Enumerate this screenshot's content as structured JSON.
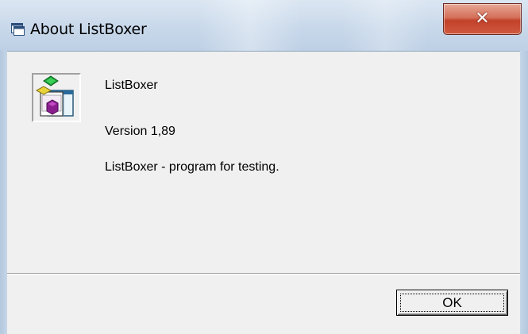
{
  "window": {
    "title": "About ListBoxer",
    "close_glyph": "✕",
    "title_icon": "app-window-icon"
  },
  "about": {
    "app_name": "ListBoxer",
    "version": "Version 1,89",
    "description": "ListBoxer - program for testing.",
    "app_icon": "listboxer-app-icon"
  },
  "buttons": {
    "ok_label": "OK"
  },
  "colors": {
    "close_button": "#c2412a",
    "client_background": "#f0f0f0",
    "frame": "#c9d8e8"
  }
}
